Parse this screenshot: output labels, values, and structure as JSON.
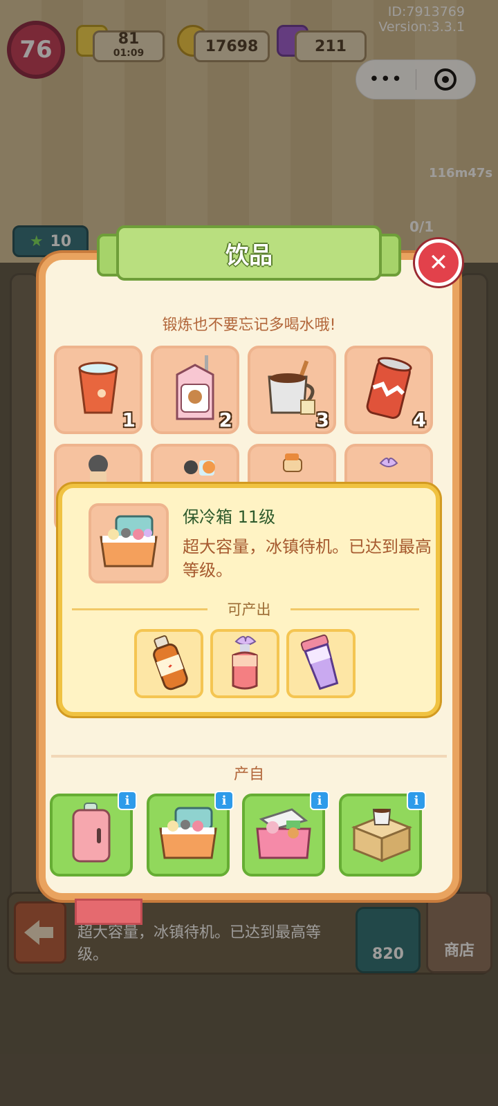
{
  "status": {
    "player_level": "76",
    "energy": "81",
    "energy_timer": "01:09",
    "coins": "17698",
    "gems": "211",
    "id_text": "ID:7913769",
    "version_text": "Version:3.3.1"
  },
  "capsule": {
    "more_icon": "more-dots-icon",
    "close_icon": "record-target-icon"
  },
  "background": {
    "timer": "116m47s",
    "counter": "0/1",
    "stars": "10",
    "bottom_desc": "超大容量，冰镇待机。已达到最高等级。",
    "bottom_coins": "820",
    "shop_label": "商店"
  },
  "dialog": {
    "title": "饮品",
    "subtitle": "锻炼也不要忘记多喝水哦!",
    "items": [
      {
        "num": "1",
        "icon": "water-cup-icon"
      },
      {
        "num": "2",
        "icon": "milk-carton-icon"
      },
      {
        "num": "3",
        "icon": "hot-cocoa-icon"
      },
      {
        "num": "4",
        "icon": "soda-can-icon"
      },
      {
        "num": "",
        "icon": "bottle-icon"
      },
      {
        "num": "",
        "icon": "ice-bottle-icon"
      },
      {
        "num": "",
        "icon": "juice-bottle-icon"
      },
      {
        "num": "",
        "icon": "bow-bottle-icon"
      }
    ],
    "from_label": "产自",
    "sources": [
      {
        "icon": "pink-fridge-icon"
      },
      {
        "icon": "cooler-box-icon"
      },
      {
        "icon": "pink-cooler-icon"
      },
      {
        "icon": "cardboard-box-icon"
      }
    ]
  },
  "popup": {
    "name": "保冷箱  11级",
    "desc": "超大容量，冰镇待机。已达到最高等级。",
    "produce_label": "可产出",
    "outputs": [
      {
        "icon": "energy-drink-icon"
      },
      {
        "icon": "bow-bottle-drink-icon"
      },
      {
        "icon": "shaker-cup-icon"
      }
    ]
  },
  "colors": {
    "panel_border": "#e9a35f",
    "title_green": "#b9df7f",
    "close_red": "#e2414b",
    "popup_border": "#f0c241"
  }
}
